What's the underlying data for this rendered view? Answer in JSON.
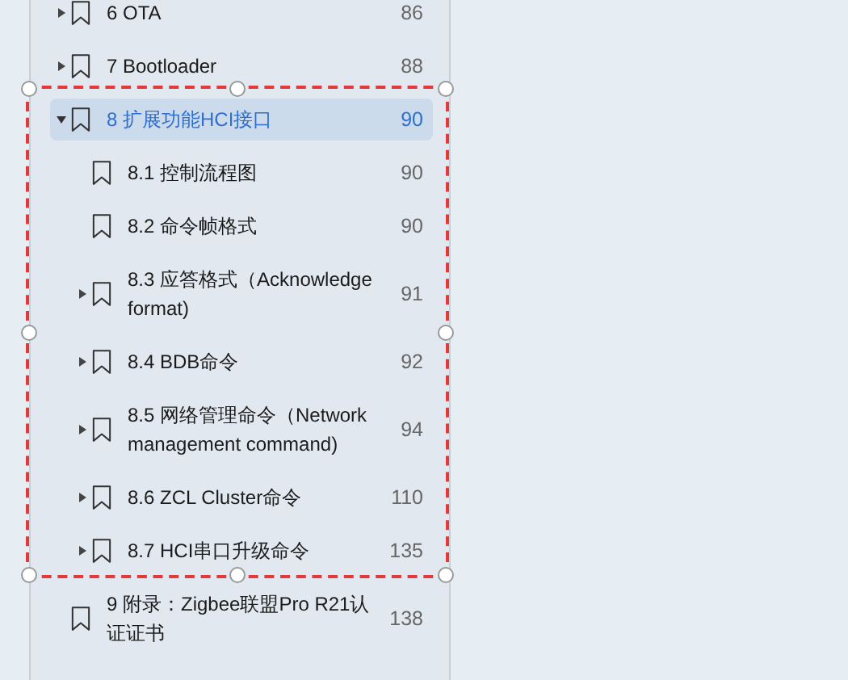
{
  "outline": [
    {
      "title": "6 OTA",
      "page": "86",
      "expanded": false,
      "selected": false
    },
    {
      "title": "7 Bootloader",
      "page": "88",
      "expanded": false,
      "selected": false
    },
    {
      "title": "8 扩展功能HCI接口",
      "page": "90",
      "expanded": true,
      "selected": true,
      "children": [
        {
          "title": "8.1 控制流程图",
          "page": "90",
          "selected": false
        },
        {
          "title": "8.2 命令帧格式",
          "page": "90",
          "selected": false
        },
        {
          "title": "8.3 应答格式（Acknowledge format)",
          "page": "91",
          "expanded": false,
          "selected": false
        },
        {
          "title": "8.4 BDB命令",
          "page": "92",
          "expanded": false,
          "selected": false
        },
        {
          "title": "8.5 网络管理命令（Network management command)",
          "page": "94",
          "expanded": false,
          "selected": false
        },
        {
          "title": "8.6 ZCL Cluster命令",
          "page": "110",
          "expanded": false,
          "selected": false
        },
        {
          "title": "8.7 HCI串口升级命令",
          "page": "135",
          "expanded": false,
          "selected": false
        }
      ]
    },
    {
      "title": "9 附录：Zigbee联盟Pro R21认证证书",
      "page": "138",
      "selected": false
    }
  ],
  "selection_frame": {
    "visible": true
  }
}
